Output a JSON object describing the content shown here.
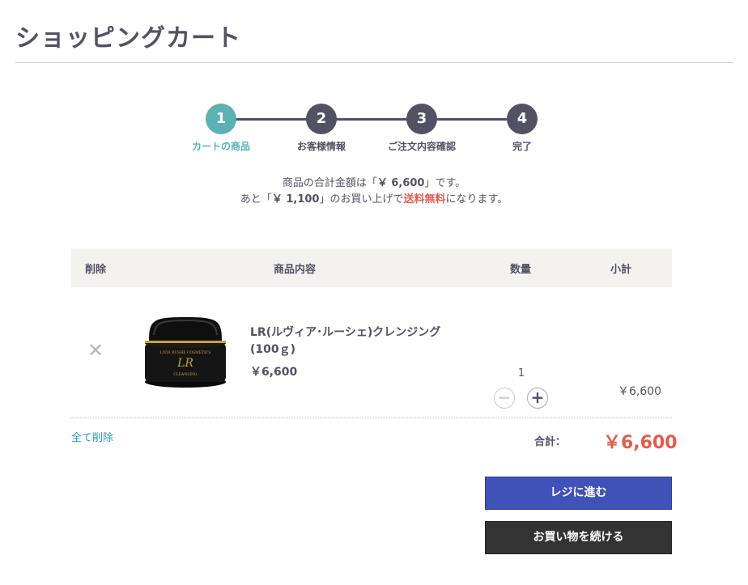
{
  "header": {
    "title": "ショッピングカート"
  },
  "steps": [
    {
      "number": "1",
      "label": "カートの商品",
      "active": true
    },
    {
      "number": "2",
      "label": "お客様情報"
    },
    {
      "number": "3",
      "label": "ご注文内容確認"
    },
    {
      "number": "4",
      "label": "完了"
    }
  ],
  "summary": {
    "line1_prefix": "商品の合計金額は「",
    "line1_amount": "￥ 6,600",
    "line1_suffix": "」です。",
    "line2_prefix": "あと「",
    "line2_amount": "￥ 1,100",
    "line2_mid": "」のお買い上げで",
    "line2_free": "送料無料",
    "line2_suffix": "になります。"
  },
  "table": {
    "headers": {
      "delete": "削除",
      "product": "商品内容",
      "quantity": "数量",
      "subtotal": "小計"
    },
    "items": [
      {
        "remove": "✕",
        "image_icon": "cream-jar-icon",
        "image_brand": "LIVIA RUSHE COSMETICS",
        "image_logo": "LR",
        "image_sub": "CLEANSING",
        "name": "LR(ルヴィア･ルーシェ)クレンジング(100ｇ)",
        "price": "￥6,600",
        "quantity": "1",
        "minus": "−",
        "plus": "+",
        "subtotal": "￥6,600"
      }
    ]
  },
  "footer": {
    "clear_all": "全て削除",
    "total_label": "合計：",
    "total_value": "￥6,600",
    "checkout": "レジに進む",
    "continue": "お買い物を続ける"
  },
  "colors": {
    "accent": "#5cb1b1",
    "primary_dark": "#525263",
    "price_red": "#de5d50",
    "checkout_blue": "#4051b8",
    "link": "#2e9ab2"
  }
}
